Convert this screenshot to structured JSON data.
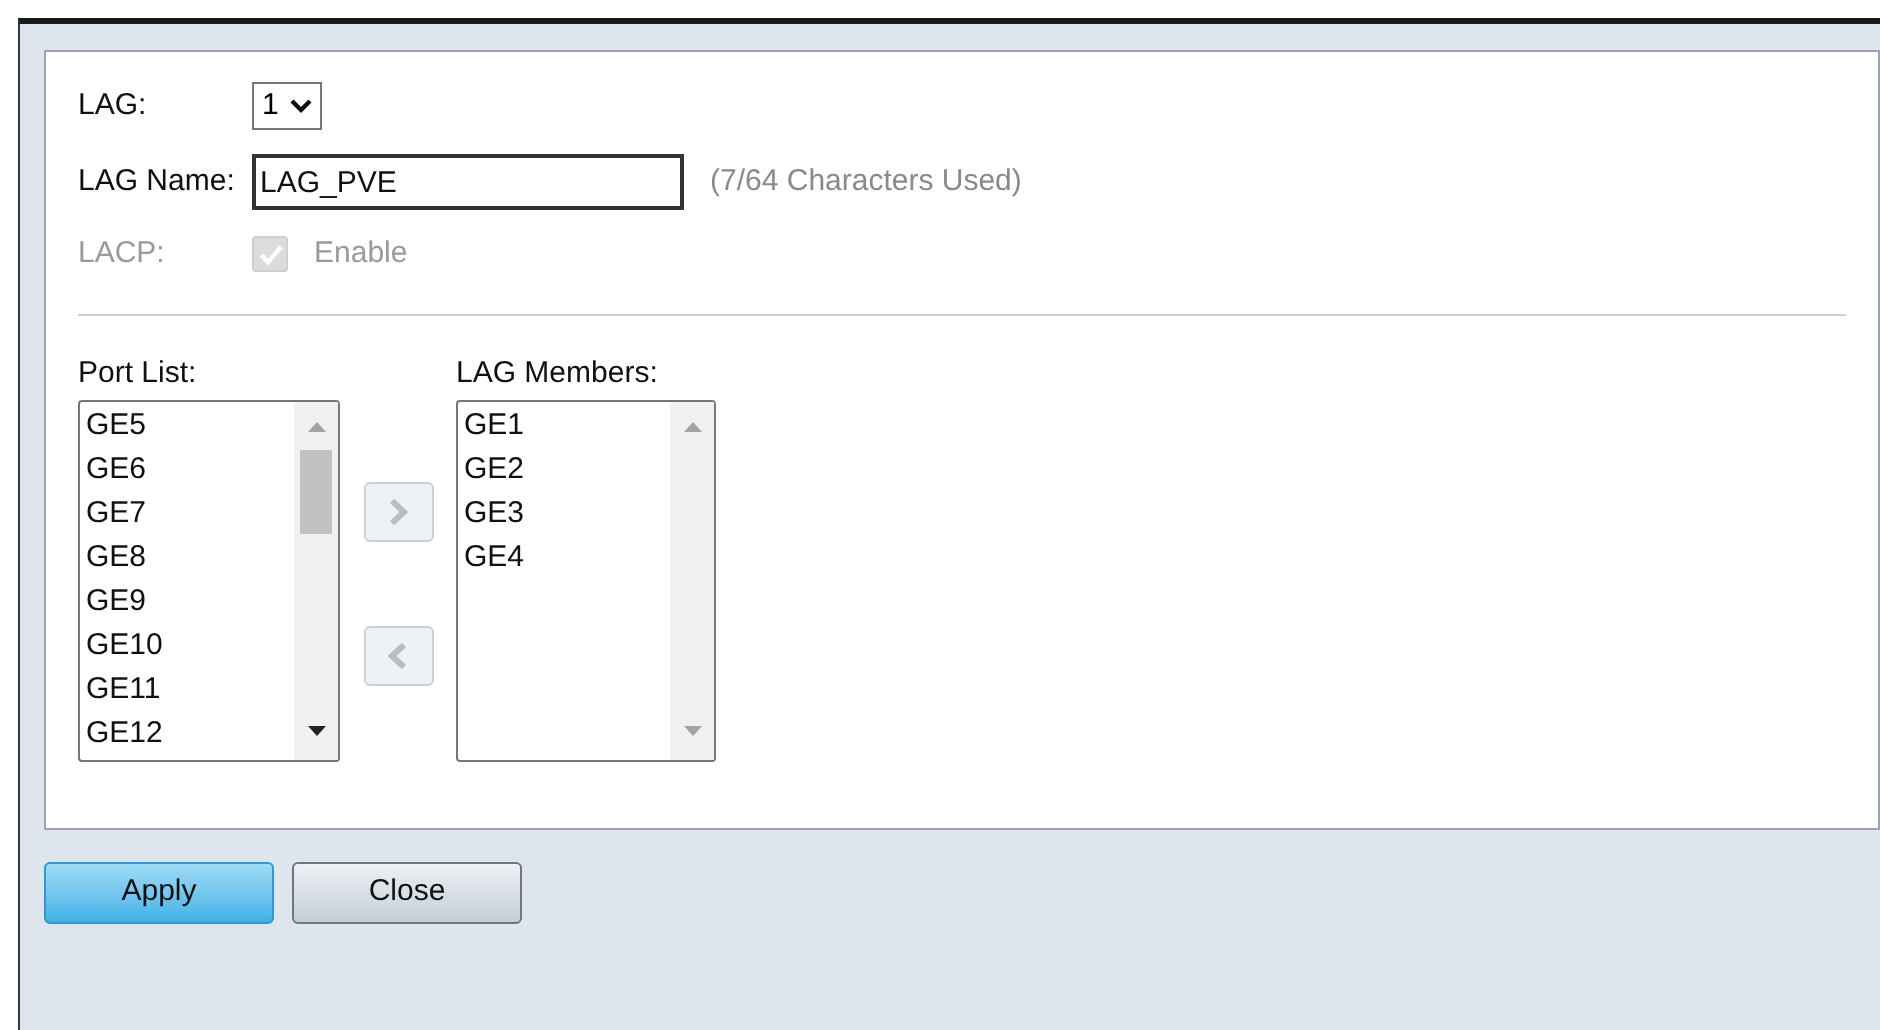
{
  "lag": {
    "label": "LAG:",
    "value": "1"
  },
  "lag_name": {
    "label": "LAG Name:",
    "value": "LAG_PVE",
    "hint": "(7/64 Characters Used)"
  },
  "lacp": {
    "label": "LACP:",
    "option": "Enable",
    "checked": true,
    "disabled": true
  },
  "port_list": {
    "label": "Port List:",
    "items": [
      "GE5",
      "GE6",
      "GE7",
      "GE8",
      "GE9",
      "GE10",
      "GE11",
      "GE12"
    ]
  },
  "lag_members": {
    "label": "LAG Members:",
    "items": [
      "GE1",
      "GE2",
      "GE3",
      "GE4"
    ]
  },
  "buttons": [
    {
      "label": "Apply",
      "kind": "primary"
    },
    {
      "label": "Close",
      "kind": "secondary"
    }
  ]
}
